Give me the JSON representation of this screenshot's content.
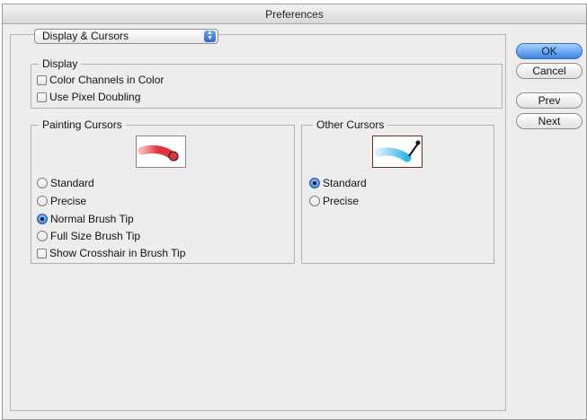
{
  "window": {
    "title": "Preferences"
  },
  "section_popup": {
    "value": "Display & Cursors"
  },
  "display_group": {
    "label": "Display",
    "options": [
      {
        "label": "Color Channels in Color",
        "checked": false
      },
      {
        "label": "Use Pixel Doubling",
        "checked": false
      }
    ]
  },
  "painting_cursors": {
    "label": "Painting Cursors",
    "preview_icon": "brush-stroke-preview-icon",
    "options": [
      {
        "label": "Standard",
        "selected": false
      },
      {
        "label": "Precise",
        "selected": false
      },
      {
        "label": "Normal Brush Tip",
        "selected": true
      },
      {
        "label": "Full Size Brush Tip",
        "selected": false
      }
    ],
    "crosshair": {
      "label": "Show Crosshair in Brush Tip",
      "checked": false
    }
  },
  "other_cursors": {
    "label": "Other Cursors",
    "preview_icon": "eyedropper-preview-icon",
    "options": [
      {
        "label": "Standard",
        "selected": true
      },
      {
        "label": "Precise",
        "selected": false
      }
    ]
  },
  "buttons": {
    "ok": "OK",
    "cancel": "Cancel",
    "prev": "Prev",
    "next": "Next"
  },
  "colors": {
    "accent": "#3b85e6",
    "brush_red": "#e0343a",
    "dropper_cyan": "#2fb4e0"
  }
}
